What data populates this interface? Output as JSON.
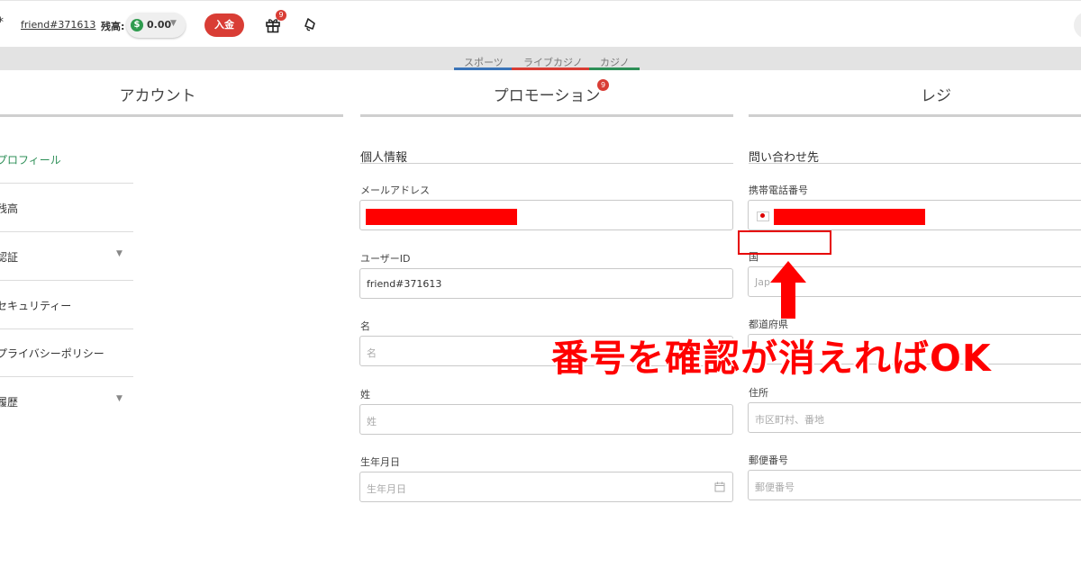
{
  "header": {
    "menu_glyph": "*",
    "user_id": "friend#371613",
    "balance_label": "残高:",
    "balance_value": "0.00",
    "balance_currency_symbol": "$",
    "deposit_label": "入金",
    "gift_badge": "9",
    "icons": [
      "dollar-icon",
      "gift-icon",
      "bell-icon"
    ]
  },
  "nav": {
    "tabs": [
      {
        "label": "スポーツ",
        "color": "#3a74b8"
      },
      {
        "label": "ライブカジノ",
        "color": "#d93d35"
      },
      {
        "label": "カジノ",
        "color": "#2d8f57"
      }
    ]
  },
  "columns": {
    "account": "アカウント",
    "promotion": "プロモーション",
    "promotion_badge": "9",
    "cashier": "レジ"
  },
  "sidebar": {
    "items": [
      {
        "label": "プロフィール",
        "active": true,
        "expandable": false
      },
      {
        "label": "残高",
        "active": false,
        "expandable": false
      },
      {
        "label": "認証",
        "active": false,
        "expandable": true
      },
      {
        "label": "セキュリティー",
        "active": false,
        "expandable": false
      },
      {
        "label": "プライバシーポリシー",
        "active": false,
        "expandable": false
      },
      {
        "label": "履歴",
        "active": false,
        "expandable": true
      }
    ]
  },
  "personal": {
    "title": "個人情報",
    "email_label": "メールアドレス",
    "user_id_label": "ユーザーID",
    "user_id_value": "friend#371613",
    "first_name_label": "名",
    "first_name_placeholder": "名",
    "last_name_label": "姓",
    "last_name_placeholder": "姓",
    "birthdate_label": "生年月日",
    "birthdate_placeholder": "生年月日"
  },
  "contact": {
    "title": "問い合わせ先",
    "phone_label": "携帯電話番号",
    "country_label": "国",
    "country_value": "Jap",
    "prefecture_label": "都道府県",
    "address_label": "住所",
    "address_placeholder": "市区町村、番地",
    "postal_label": "郵便番号",
    "postal_placeholder": "郵便番号"
  },
  "annotation": {
    "text": "番号を確認が消えればOK",
    "color": "#ff0000"
  }
}
